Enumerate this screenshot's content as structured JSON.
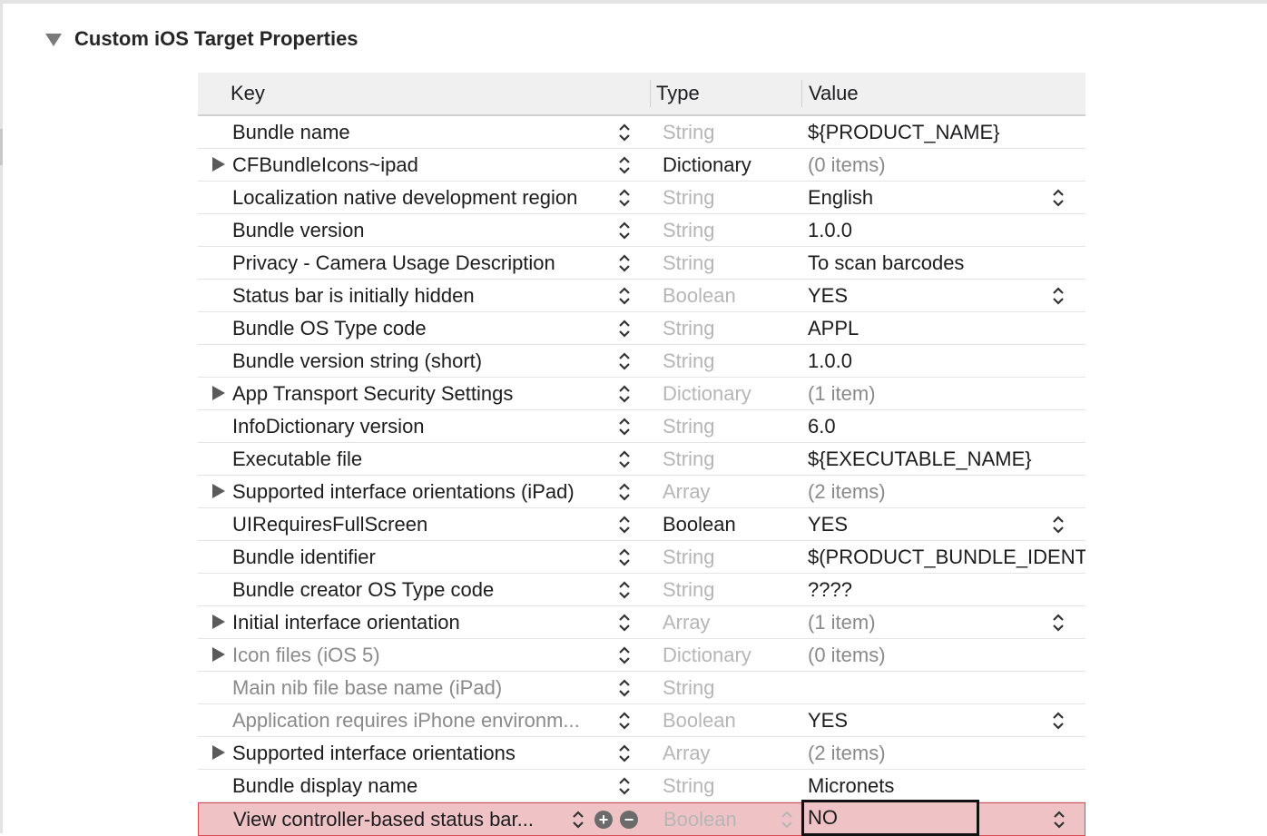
{
  "section": {
    "title": "Custom iOS Target Properties"
  },
  "columns": {
    "key": "Key",
    "type": "Type",
    "value": "Value"
  },
  "rows": [
    {
      "key": "Bundle name",
      "type": "String",
      "value": "${PRODUCT_NAME}",
      "expandable": false,
      "type_strong": false,
      "value_dim": false,
      "value_stepper": false,
      "key_dim": false
    },
    {
      "key": "CFBundleIcons~ipad",
      "type": "Dictionary",
      "value": "(0 items)",
      "expandable": true,
      "type_strong": true,
      "value_dim": true,
      "value_stepper": false,
      "key_dim": false
    },
    {
      "key": "Localization native development region",
      "type": "String",
      "value": "English",
      "expandable": false,
      "type_strong": false,
      "value_dim": false,
      "value_stepper": true,
      "key_dim": false
    },
    {
      "key": "Bundle version",
      "type": "String",
      "value": "1.0.0",
      "expandable": false,
      "type_strong": false,
      "value_dim": false,
      "value_stepper": false,
      "key_dim": false
    },
    {
      "key": "Privacy - Camera Usage Description",
      "type": "String",
      "value": "To scan barcodes",
      "expandable": false,
      "type_strong": false,
      "value_dim": false,
      "value_stepper": false,
      "key_dim": false
    },
    {
      "key": "Status bar is initially hidden",
      "type": "Boolean",
      "value": "YES",
      "expandable": false,
      "type_strong": false,
      "value_dim": false,
      "value_stepper": true,
      "key_dim": false
    },
    {
      "key": "Bundle OS Type code",
      "type": "String",
      "value": "APPL",
      "expandable": false,
      "type_strong": false,
      "value_dim": false,
      "value_stepper": false,
      "key_dim": false
    },
    {
      "key": "Bundle version string (short)",
      "type": "String",
      "value": "1.0.0",
      "expandable": false,
      "type_strong": false,
      "value_dim": false,
      "value_stepper": false,
      "key_dim": false
    },
    {
      "key": "App Transport Security Settings",
      "type": "Dictionary",
      "value": "(1 item)",
      "expandable": true,
      "type_strong": false,
      "value_dim": true,
      "value_stepper": false,
      "key_dim": false
    },
    {
      "key": "InfoDictionary version",
      "type": "String",
      "value": "6.0",
      "expandable": false,
      "type_strong": false,
      "value_dim": false,
      "value_stepper": false,
      "key_dim": false
    },
    {
      "key": "Executable file",
      "type": "String",
      "value": "${EXECUTABLE_NAME}",
      "expandable": false,
      "type_strong": false,
      "value_dim": false,
      "value_stepper": false,
      "key_dim": false
    },
    {
      "key": "Supported interface orientations (iPad)",
      "type": "Array",
      "value": "(2 items)",
      "expandable": true,
      "type_strong": false,
      "value_dim": true,
      "value_stepper": false,
      "key_dim": false
    },
    {
      "key": "UIRequiresFullScreen",
      "type": "Boolean",
      "value": "YES",
      "expandable": false,
      "type_strong": true,
      "value_dim": false,
      "value_stepper": true,
      "key_dim": false
    },
    {
      "key": "Bundle identifier",
      "type": "String",
      "value": "$(PRODUCT_BUNDLE_IDENT",
      "expandable": false,
      "type_strong": false,
      "value_dim": false,
      "value_stepper": false,
      "key_dim": false
    },
    {
      "key": "Bundle creator OS Type code",
      "type": "String",
      "value": "????",
      "expandable": false,
      "type_strong": false,
      "value_dim": false,
      "value_stepper": false,
      "key_dim": false
    },
    {
      "key": "Initial interface orientation",
      "type": "Array",
      "value": "(1 item)",
      "expandable": true,
      "type_strong": false,
      "value_dim": true,
      "value_stepper": true,
      "key_dim": false
    },
    {
      "key": "Icon files (iOS 5)",
      "type": "Dictionary",
      "value": "(0 items)",
      "expandable": true,
      "type_strong": false,
      "value_dim": true,
      "value_stepper": false,
      "key_dim": true
    },
    {
      "key": "Main nib file base name (iPad)",
      "type": "String",
      "value": "",
      "expandable": false,
      "type_strong": false,
      "value_dim": false,
      "value_stepper": false,
      "key_dim": true
    },
    {
      "key": "Application requires iPhone environm...",
      "type": "Boolean",
      "value": "YES",
      "expandable": false,
      "type_strong": false,
      "value_dim": false,
      "value_stepper": true,
      "key_dim": true
    },
    {
      "key": "Supported interface orientations",
      "type": "Array",
      "value": "(2 items)",
      "expandable": true,
      "type_strong": false,
      "value_dim": true,
      "value_stepper": false,
      "key_dim": false
    },
    {
      "key": "Bundle display name",
      "type": "String",
      "value": "Micronets",
      "expandable": false,
      "type_strong": false,
      "value_dim": false,
      "value_stepper": false,
      "key_dim": false
    }
  ],
  "selected_row": {
    "key": "View controller-based status bar...",
    "type": "Boolean",
    "value": "NO",
    "add_label": "+",
    "remove_label": "−"
  }
}
